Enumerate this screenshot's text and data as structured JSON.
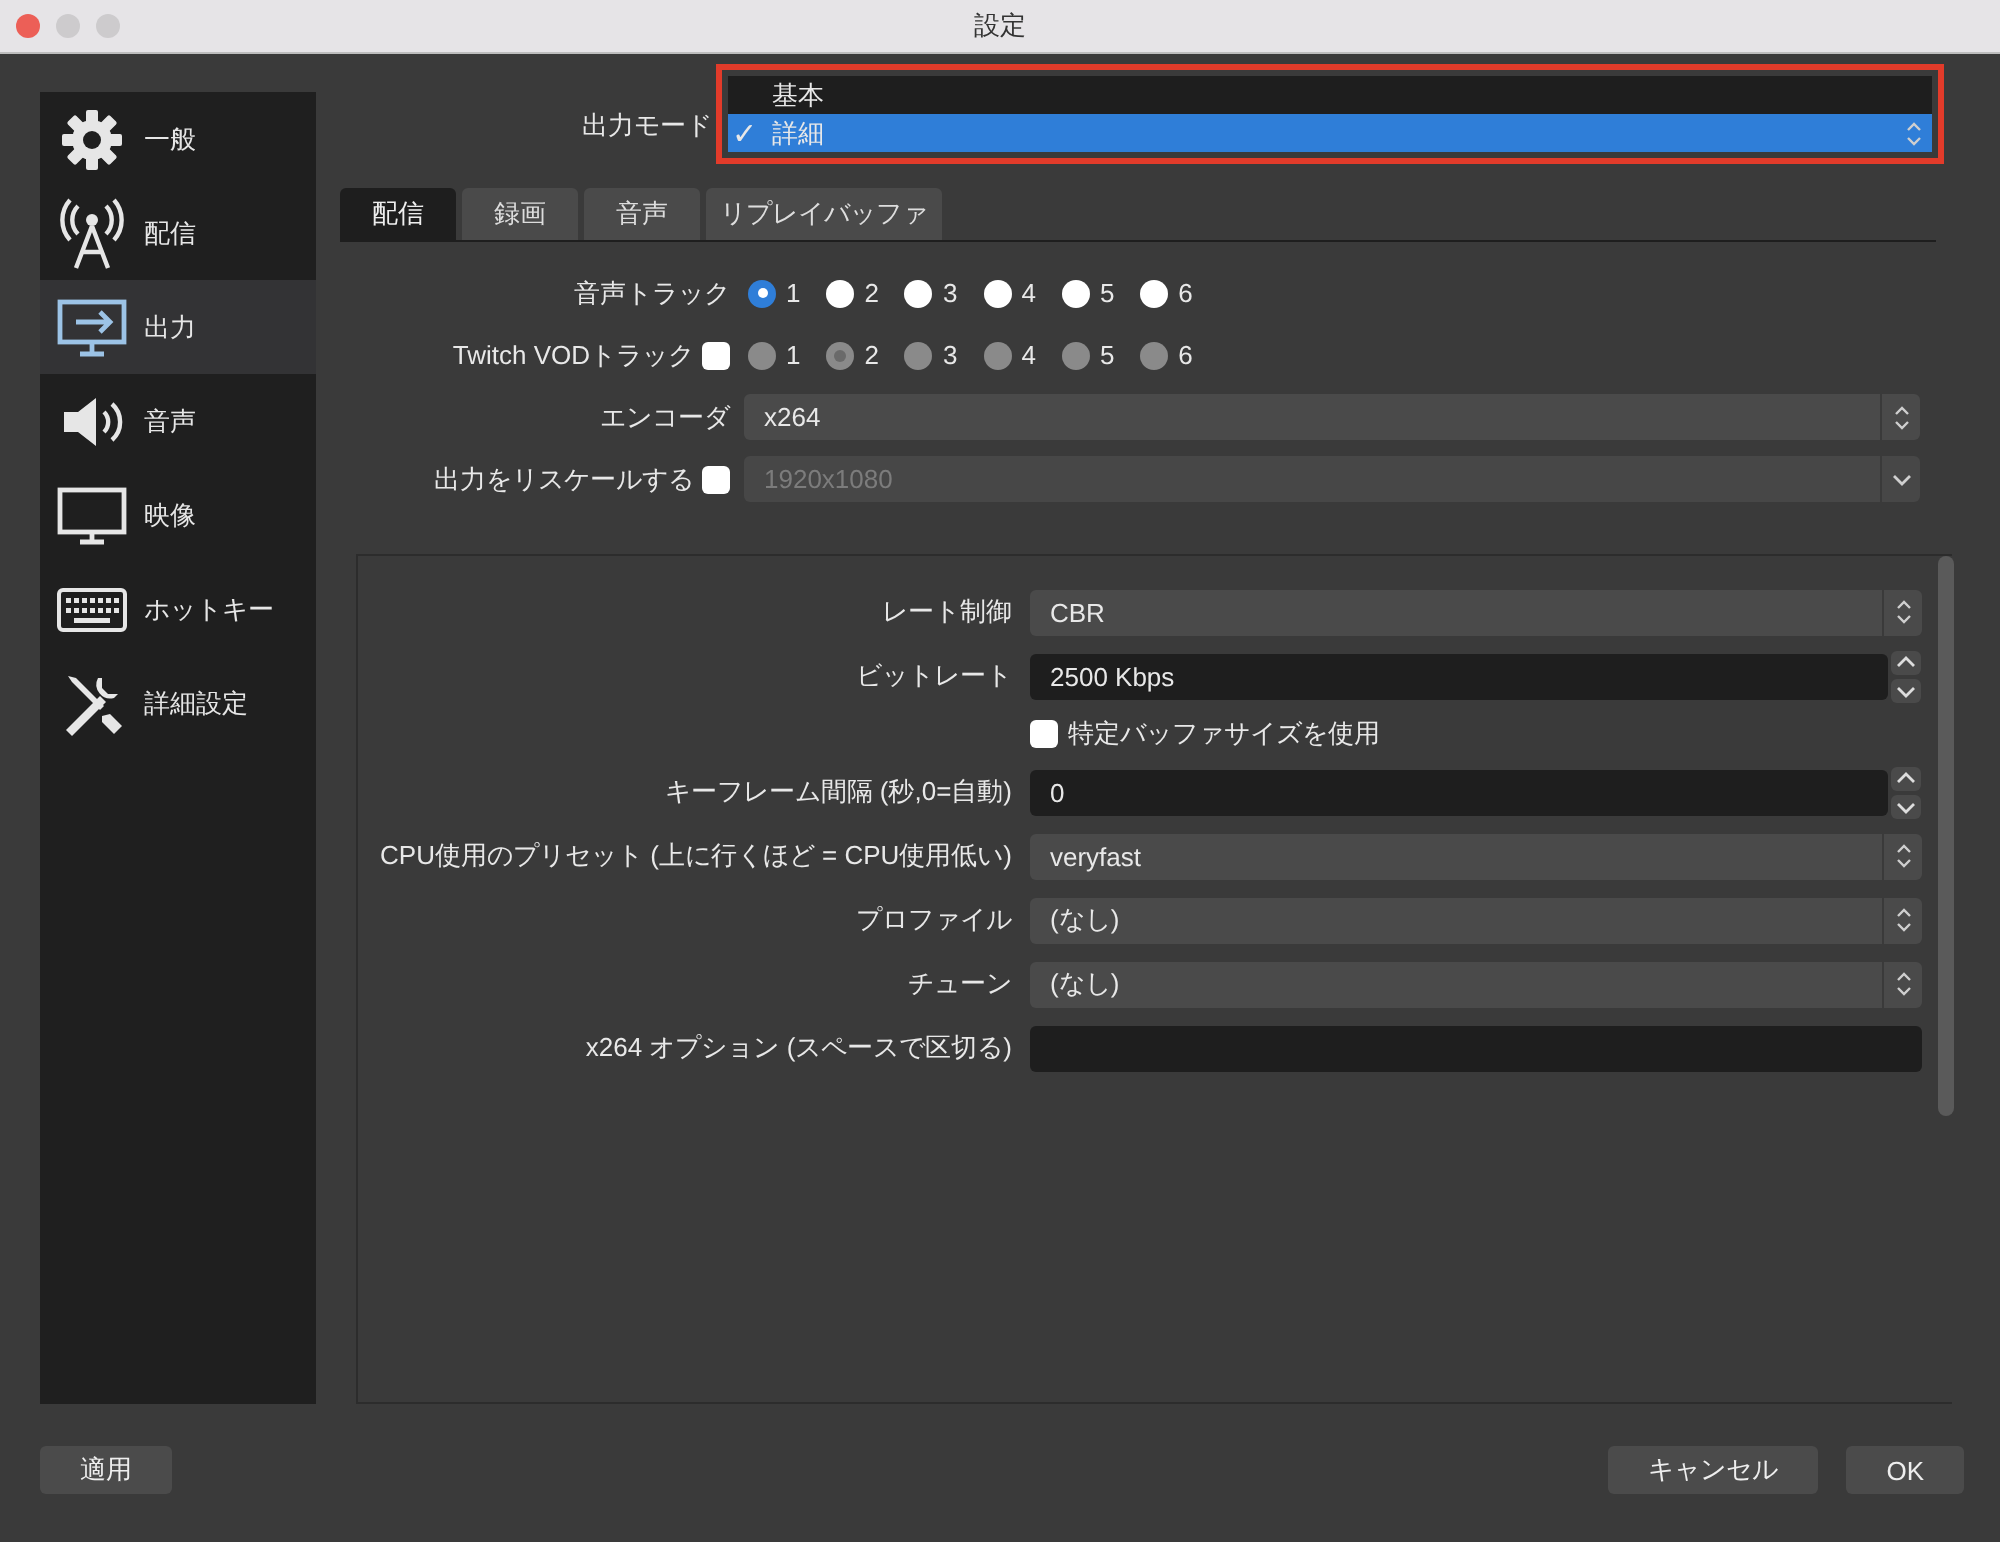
{
  "window": {
    "title": "設定"
  },
  "sidebar": {
    "items": [
      {
        "label": "一般",
        "kind": "gear",
        "selected": false
      },
      {
        "label": "配信",
        "kind": "tower",
        "selected": false
      },
      {
        "label": "出力",
        "kind": "output",
        "selected": true
      },
      {
        "label": "音声",
        "kind": "speaker",
        "selected": false
      },
      {
        "label": "映像",
        "kind": "monitor",
        "selected": false
      },
      {
        "label": "ホットキー",
        "kind": "keyboard",
        "selected": false
      },
      {
        "label": "詳細設定",
        "kind": "tools",
        "selected": false
      }
    ]
  },
  "output_mode": {
    "label": "出力モード",
    "highlighted": true,
    "check": "✓",
    "options": [
      {
        "label": "基本",
        "selected": false
      },
      {
        "label": "詳細",
        "selected": true
      }
    ]
  },
  "tabs": [
    {
      "label": "配信",
      "selected": true
    },
    {
      "label": "録画",
      "selected": false
    },
    {
      "label": "音声",
      "selected": false
    },
    {
      "label": "リプレイバッファ",
      "selected": false
    }
  ],
  "radio_groups": [
    {
      "label": "音声トラック",
      "disabled": false,
      "options": [
        {
          "label": "1",
          "selected": true
        },
        {
          "label": "2",
          "selected": false
        },
        {
          "label": "3",
          "selected": false
        },
        {
          "label": "4",
          "selected": false
        },
        {
          "label": "5",
          "selected": false
        },
        {
          "label": "6",
          "selected": false
        }
      ]
    },
    {
      "label": "Twitch VODトラック",
      "checked": false,
      "disabled": true,
      "options": [
        {
          "label": "1",
          "selected": false
        },
        {
          "label": "2",
          "selected": true
        },
        {
          "label": "3",
          "selected": false
        },
        {
          "label": "4",
          "selected": false
        },
        {
          "label": "5",
          "selected": false
        },
        {
          "label": "6",
          "selected": false
        }
      ]
    }
  ],
  "encoder": {
    "label": "エンコーダ",
    "value": "x264"
  },
  "rescale": {
    "label": "出力をリスケールする",
    "checked": false,
    "disabled": true,
    "value": "1920x1080"
  },
  "encoder_settings": [
    {
      "kind": "select",
      "label": "レート制御",
      "value": "CBR"
    },
    {
      "kind": "spin",
      "label": "ビットレート",
      "value": "2500 Kbps"
    },
    {
      "kind": "checkbox",
      "label": "特定バッファサイズを使用",
      "checked": false
    },
    {
      "kind": "spin",
      "label": "キーフレーム間隔 (秒,0=自動)",
      "value": "0"
    },
    {
      "kind": "select",
      "label": "CPU使用のプリセット (上に行くほど = CPU使用低い)",
      "value": "veryfast"
    },
    {
      "kind": "select",
      "label": "プロファイル",
      "value": "(なし)"
    },
    {
      "kind": "select",
      "label": "チューン",
      "value": "(なし)"
    },
    {
      "kind": "text",
      "label": "x264 オプション (スペースで区切る)"
    }
  ],
  "footer": {
    "left": [
      "適用"
    ],
    "right": [
      "キャンセル",
      "OK"
    ]
  }
}
